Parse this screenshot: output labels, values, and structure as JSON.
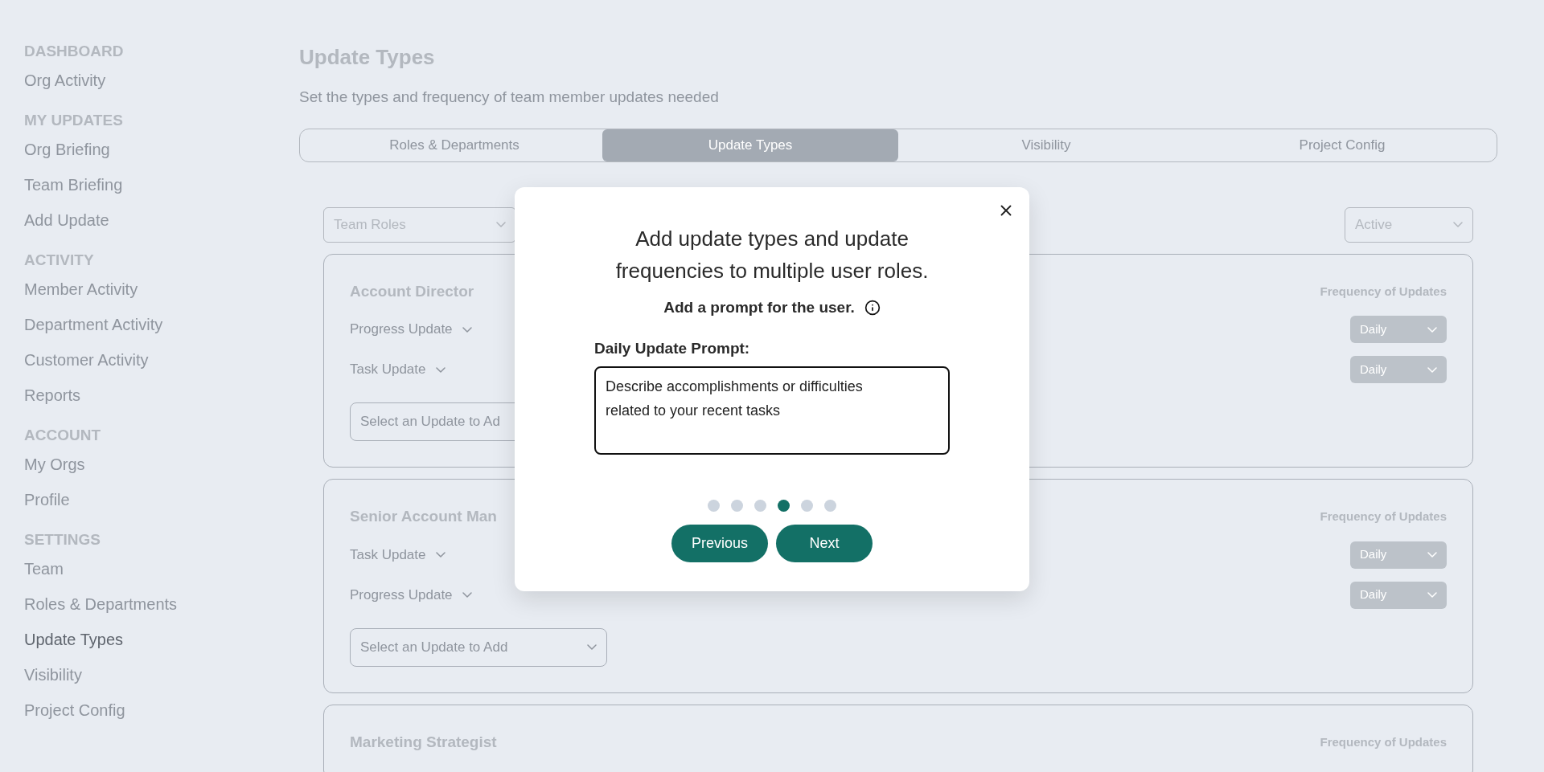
{
  "sidebar": {
    "sections": [
      {
        "heading": "DASHBOARD",
        "items": [
          {
            "label": "Org Activity",
            "selected": false
          }
        ]
      },
      {
        "heading": "MY UPDATES",
        "items": [
          {
            "label": "Org Briefing",
            "selected": false
          },
          {
            "label": "Team Briefing",
            "selected": false
          },
          {
            "label": "Add Update",
            "selected": false
          }
        ]
      },
      {
        "heading": "ACTIVITY",
        "items": [
          {
            "label": "Member Activity",
            "selected": false
          },
          {
            "label": "Department Activity",
            "selected": false
          },
          {
            "label": "Customer Activity",
            "selected": false
          },
          {
            "label": "Reports",
            "selected": false
          }
        ]
      },
      {
        "heading": "ACCOUNT",
        "items": [
          {
            "label": "My Orgs",
            "selected": false
          },
          {
            "label": "Profile",
            "selected": false
          }
        ]
      },
      {
        "heading": "SETTINGS",
        "items": [
          {
            "label": "Team",
            "selected": false
          },
          {
            "label": "Roles & Departments",
            "selected": false
          },
          {
            "label": "Update Types",
            "selected": true
          },
          {
            "label": "Visibility",
            "selected": false
          },
          {
            "label": "Project Config",
            "selected": false
          }
        ]
      }
    ]
  },
  "page": {
    "title": "Update Types",
    "subtitle": "Set the types and frequency of team member updates needed"
  },
  "tabs": [
    {
      "label": "Roles & Departments",
      "selected": false
    },
    {
      "label": "Update Types",
      "selected": true
    },
    {
      "label": "Visibility",
      "selected": false
    },
    {
      "label": "Project Config",
      "selected": false
    }
  ],
  "filters": {
    "left": "Team Roles",
    "right": "Active"
  },
  "roles": [
    {
      "name": "Account Director",
      "frequency_label": "Frequency of Updates",
      "updates": [
        {
          "label": "Progress Update",
          "frequency": "Daily"
        },
        {
          "label": "Task Update",
          "frequency": "Daily"
        }
      ],
      "add_placeholder": "Select an Update to Ad"
    },
    {
      "name": "Senior Account Man",
      "frequency_label": "Frequency of Updates",
      "updates": [
        {
          "label": "Task Update",
          "frequency": "Daily"
        },
        {
          "label": "Progress Update",
          "frequency": "Daily"
        }
      ],
      "add_placeholder": "Select an Update to Add"
    },
    {
      "name": "Marketing Strategist",
      "frequency_label": "Frequency of Updates"
    }
  ],
  "modal": {
    "title": "Add update types and update frequencies to multiple user roles.",
    "subtitle": "Add a prompt for the user.",
    "field_label": "Daily Update Prompt:",
    "prompt_value": "Describe accomplishments or difficulties related to your recent tasks",
    "steps": [
      {
        "selected": false
      },
      {
        "selected": false
      },
      {
        "selected": false
      },
      {
        "selected": true
      },
      {
        "selected": false
      },
      {
        "selected": false
      }
    ],
    "buttons": [
      {
        "label": "Previous"
      },
      {
        "label": "Next"
      }
    ]
  }
}
